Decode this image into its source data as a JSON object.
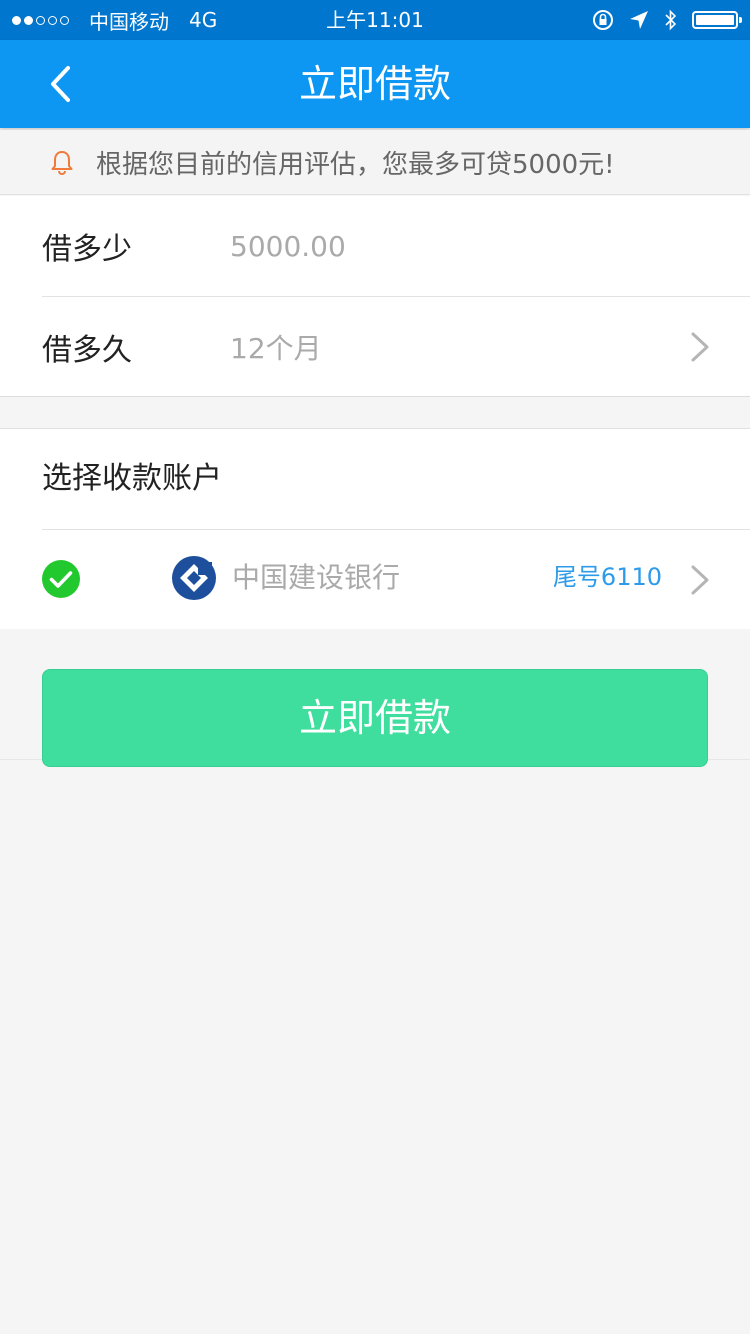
{
  "status_bar": {
    "carrier": "中国移动",
    "network": "4G",
    "time": "上午11:01",
    "icons": [
      "signal-dots-icon",
      "orientation-lock-icon",
      "location-arrow-icon",
      "bluetooth-icon",
      "battery-icon"
    ]
  },
  "nav": {
    "title": "立即借款",
    "back_icon": "chevron-left-icon"
  },
  "notice": {
    "icon": "bell-icon",
    "text": "根据您目前的信用评估，您最多可贷5000元!"
  },
  "loan_form": {
    "amount_label": "借多少",
    "amount_value": "5000.00",
    "term_label": "借多久",
    "term_value": "12个月"
  },
  "account": {
    "header": "选择收款账户",
    "bank_name": "中国建设银行",
    "tail_number": "尾号6110",
    "selected": true
  },
  "submit": {
    "label": "立即借款"
  },
  "colors": {
    "status_bar": "#0076cf",
    "nav_bar": "#0d96f2",
    "primary_button": "#3fde9e",
    "accent_text": "#2d9be9",
    "check_green": "#22c92e",
    "bank_blue": "#1d4f9c",
    "bell_orange": "#f07a3c"
  }
}
